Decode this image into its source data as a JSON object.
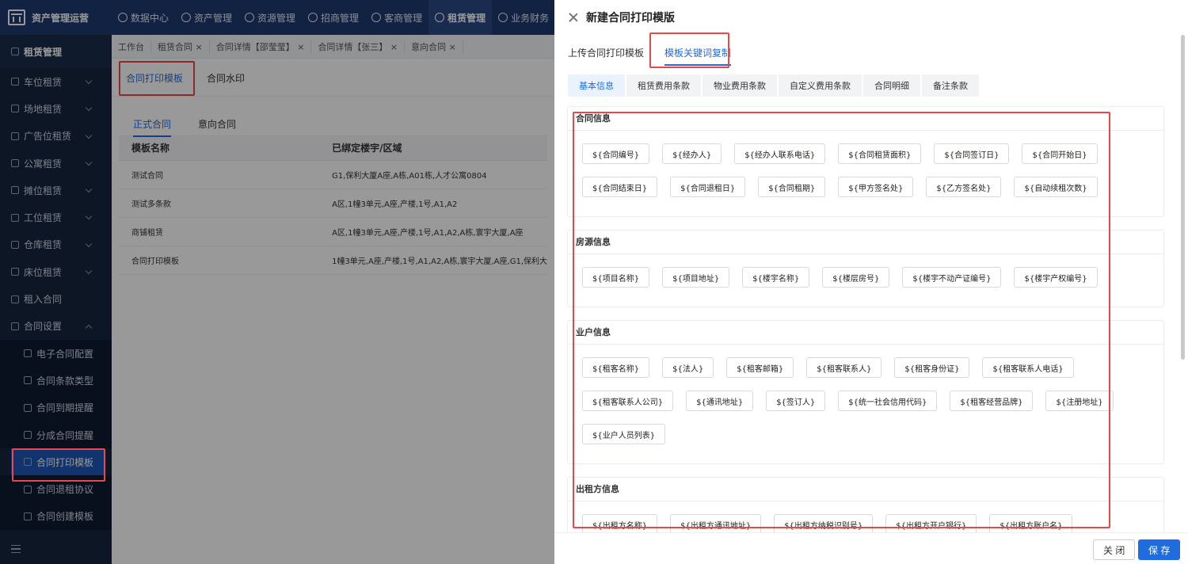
{
  "app": {
    "title": "资产管理运营"
  },
  "topnav": [
    {
      "label": "数据中心"
    },
    {
      "label": "资产管理"
    },
    {
      "label": "资源管理"
    },
    {
      "label": "招商管理"
    },
    {
      "label": "客商管理"
    },
    {
      "label": "租赁管理"
    },
    {
      "label": "业务财务"
    }
  ],
  "sidebar": {
    "header": "租赁管理",
    "items": [
      {
        "label": "车位租赁"
      },
      {
        "label": "场地租赁"
      },
      {
        "label": "广告位租赁"
      },
      {
        "label": "公寓租赁"
      },
      {
        "label": "摊位租赁"
      },
      {
        "label": "工位租赁"
      },
      {
        "label": "仓库租赁"
      },
      {
        "label": "床位租赁"
      },
      {
        "label": "租入合同"
      },
      {
        "label": "合同设置"
      }
    ],
    "subitems": [
      {
        "label": "电子合同配置"
      },
      {
        "label": "合同条款类型"
      },
      {
        "label": "合同到期提醒"
      },
      {
        "label": "分成合同提醒"
      },
      {
        "label": "合同打印模板"
      },
      {
        "label": "合同退租协议"
      },
      {
        "label": "合同创建模板"
      }
    ]
  },
  "tabsbar": [
    "工作台",
    "租赁合同 ×",
    "合同详情【邵莹莹】 ×",
    "合同详情【张三】 ×",
    "意向合同 ×"
  ],
  "main": {
    "subtabs": [
      "合同打印模板",
      "合同水印"
    ],
    "inner_tabs": [
      "正式合同",
      "意向合同"
    ],
    "columns": [
      "模板名称",
      "已绑定楼宇/区域"
    ],
    "rows": [
      {
        "name": "测试合同",
        "area": "G1,保利大厦A座,A栋,A01栋,人才公寓0804"
      },
      {
        "name": "测试多条款",
        "area": "A区,1幢3单元,A座,产楼,1号,A1,A2"
      },
      {
        "name": "商铺租赁",
        "area": "A区,1幢3单元,A座,产楼,1号,A1,A2,A栋,寰宇大厦,A座"
      },
      {
        "name": "合同打印模板",
        "area": "1幢3单元,A座,产楼,1号,A1,A2,A栋,寰宇大厦,A座,G1,保利大"
      }
    ]
  },
  "drawer": {
    "title": "新建合同打印模版",
    "tabs": [
      "上传合同打印模板",
      "模板关键词复制"
    ],
    "segments": [
      "基本信息",
      "租赁费用条款",
      "物业费用条款",
      "自定义费用条款",
      "合同明细",
      "备注条款"
    ],
    "sections": [
      {
        "title": "合同信息",
        "chips": [
          "${合同编号}",
          "${经办人}",
          "${经办人联系电话}",
          "${合同租赁面积}",
          "${合同签订日}",
          "${合同开始日}",
          "${合同结束日}",
          "${合同退租日}",
          "${合同租期}",
          "${甲方签名处}",
          "${乙方签名处}",
          "${自动续租次数}"
        ]
      },
      {
        "title": "房源信息",
        "chips": [
          "${项目名称}",
          "${项目地址}",
          "${楼宇名称}",
          "${楼层房号}",
          "${楼宇不动产证编号}",
          "${楼宇产权编号}"
        ]
      },
      {
        "title": "业户信息",
        "chips": [
          "${租客名称}",
          "${法人}",
          "${租客邮箱}",
          "${租客联系人}",
          "${租客身份证}",
          "${租客联系人电话}",
          "${租客联系人公司}",
          "${通讯地址}",
          "${签订人}",
          "${统一社会信用代码}",
          "${租客经营品牌}",
          "${注册地址}",
          "${业户人员列表}"
        ]
      },
      {
        "title": "出租方信息",
        "chips": [
          "${出租方名称}",
          "${出租方通讯地址}",
          "${出租方纳税识别号}",
          "${出租方开户银行}",
          "${出租方账户名}"
        ]
      }
    ],
    "footer": {
      "close": "关 闭",
      "save": "保 存"
    }
  },
  "colors": {
    "accent": "#1e6ce0",
    "nav_bg": "#1f3a6e",
    "sidebar_bg": "#16263f",
    "highlight": "#e8484b"
  }
}
